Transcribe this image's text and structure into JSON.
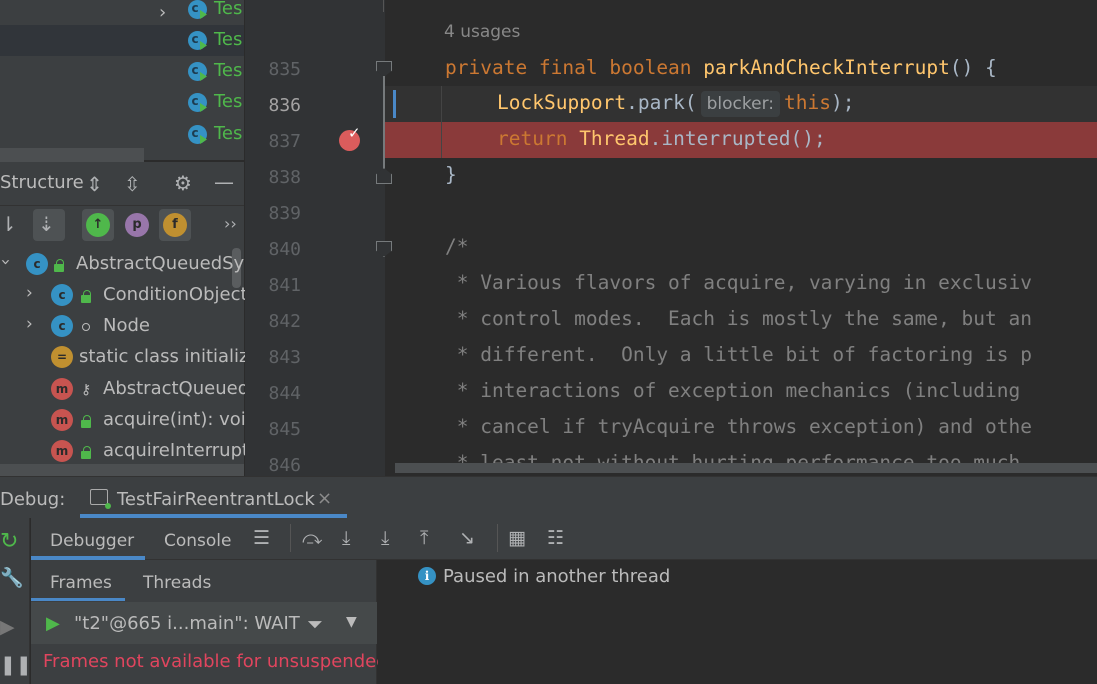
{
  "project_tree": {
    "items": [
      {
        "label": "Tes",
        "icon": "class-icon"
      },
      {
        "label": "Tes",
        "icon": "class-icon"
      },
      {
        "label": "Tes",
        "icon": "class-icon"
      },
      {
        "label": "Tes",
        "icon": "class-icon"
      },
      {
        "label": "Tes",
        "icon": "class-icon"
      }
    ]
  },
  "structure": {
    "title": "Structure",
    "items": [
      {
        "label": "AbstractQueuedSyr",
        "kind": "c"
      },
      {
        "label": "ConditionObject",
        "kind": "c"
      },
      {
        "label": "Node",
        "kind": "c"
      },
      {
        "label": "static class initialize",
        "kind": "="
      },
      {
        "label": "AbstractQueued",
        "kind": "m"
      },
      {
        "label": "acquire(int): voic",
        "kind": "m"
      },
      {
        "label": "acquireInterrupt",
        "kind": "m"
      }
    ],
    "filter_badges": [
      "p",
      "f"
    ]
  },
  "editor": {
    "usages": "4 usages",
    "lines": [
      {
        "num": "835"
      },
      {
        "num": "836"
      },
      {
        "num": "837"
      },
      {
        "num": "838"
      },
      {
        "num": "839"
      },
      {
        "num": "840"
      },
      {
        "num": "841"
      },
      {
        "num": "842"
      },
      {
        "num": "843"
      },
      {
        "num": "844"
      },
      {
        "num": "845"
      },
      {
        "num": "846"
      }
    ],
    "code": {
      "l835_kw": "private final boolean ",
      "l835_fn": "parkAndCheckInterrupt",
      "l835_rest": "() {",
      "l836_cls": "LockSupport",
      "l836_dot": ".",
      "l836_mth": "park",
      "l836_open": "(",
      "l836_hint": "blocker:",
      "l836_this": "this",
      "l836_close": ");",
      "l837_kw": "return ",
      "l837_cls": "Thread",
      "l837_dot": ".",
      "l837_mth": "interrupted",
      "l837_rest": "();",
      "l838": "}",
      "l840": "/*",
      "l841": " * Various flavors of acquire, varying in exclusiv",
      "l842": " * control modes.  Each is mostly the same, but an",
      "l843": " * different.  Only a little bit of factoring is p",
      "l844": " * interactions of exception mechanics (including ",
      "l845": " * cancel if tryAcquire throws exception) and othe",
      "l846": " * least not without hurting performance too much."
    }
  },
  "debug": {
    "label": "Debug:",
    "session_tab": "TestFairReentrantLock",
    "close_glyph": "×",
    "tabs": {
      "debugger": "Debugger",
      "console": "Console"
    },
    "subtabs": {
      "frames": "Frames",
      "threads": "Threads"
    },
    "thread_selector": "\"t2\"@665 i...main\": WAIT",
    "frames_message": "Frames not available for unsuspended",
    "status_message": "Paused in another thread",
    "info_glyph": "i"
  }
}
